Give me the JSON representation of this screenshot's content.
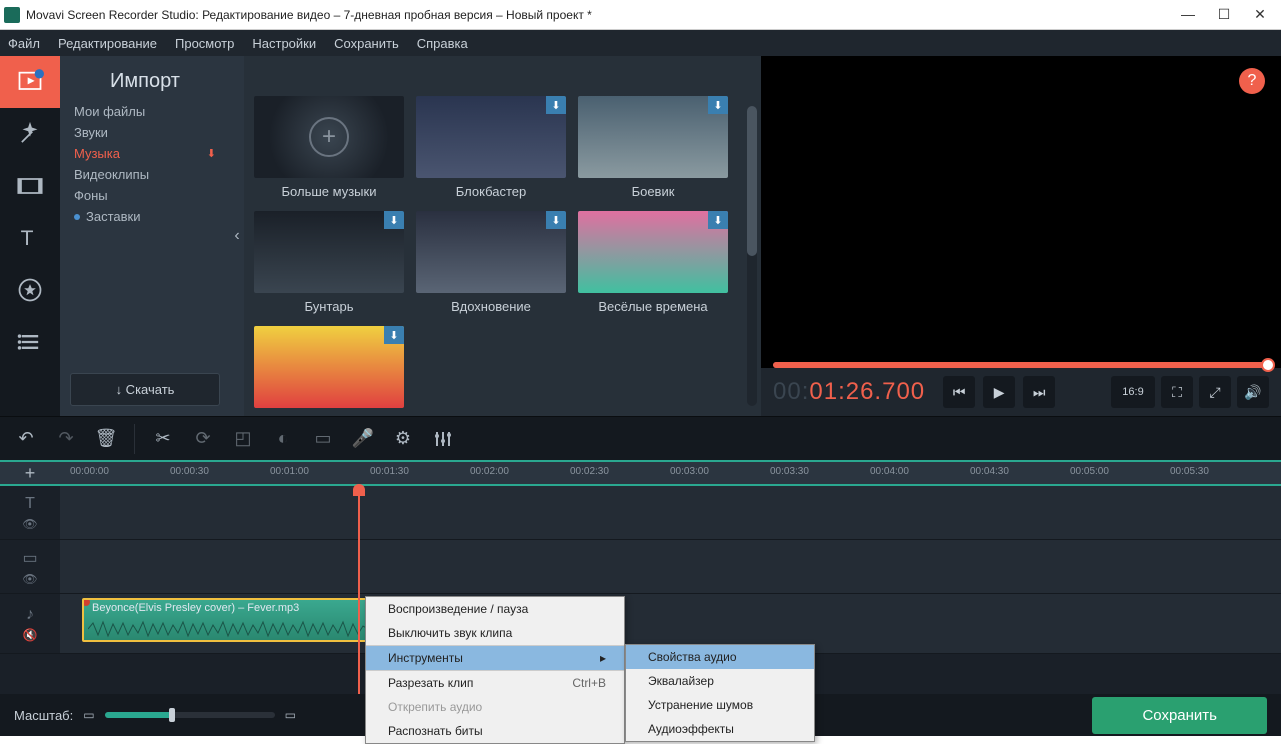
{
  "window": {
    "title": "Movavi Screen Recorder Studio: Редактирование видео – 7-дневная пробная версия – Новый проект *"
  },
  "menu": {
    "file": "Файл",
    "edit": "Редактирование",
    "view": "Просмотр",
    "settings": "Настройки",
    "save": "Сохранить",
    "help": "Справка"
  },
  "import": {
    "title": "Импорт",
    "categories": {
      "my_files": "Мои файлы",
      "sounds": "Звуки",
      "music": "Музыка",
      "videoclips": "Видеоклипы",
      "backgrounds": "Фоны",
      "intros": "Заставки"
    },
    "download_btn": "↓ Скачать",
    "thumbs": {
      "more_music": "Больше музыки",
      "blockbuster": "Блокбастер",
      "action": "Боевик",
      "rebel": "Бунтарь",
      "inspiration": "Вдохновение",
      "fun_times": "Весёлые времена"
    }
  },
  "preview": {
    "timecode_gray": "00:",
    "timecode_active": "01:26.700",
    "aspect": "16:9"
  },
  "timeline": {
    "ticks": [
      "00:00:00",
      "00:00:30",
      "00:01:00",
      "00:01:30",
      "00:02:00",
      "00:02:30",
      "00:03:00",
      "00:03:30",
      "00:04:00",
      "00:04:30",
      "00:05:00",
      "00:05:30"
    ],
    "audio_clip": "Beyonce(Elvis Presley cover) – Fever.mp3"
  },
  "context1": {
    "play_pause": "Воспроизведение / пауза",
    "mute_clip": "Выключить звук клипа",
    "tools": "Инструменты",
    "cut_clip": "Разрезать клип",
    "cut_shortcut": "Ctrl+B",
    "detach_audio": "Открепить аудио",
    "detect_beats": "Распознать биты"
  },
  "context2": {
    "audio_props": "Свойства аудио",
    "equalizer": "Эквалайзер",
    "noise_removal": "Устранение шумов",
    "audio_effects": "Аудиоэффекты"
  },
  "footer": {
    "zoom": "Масштаб:",
    "save": "Сохранить"
  }
}
